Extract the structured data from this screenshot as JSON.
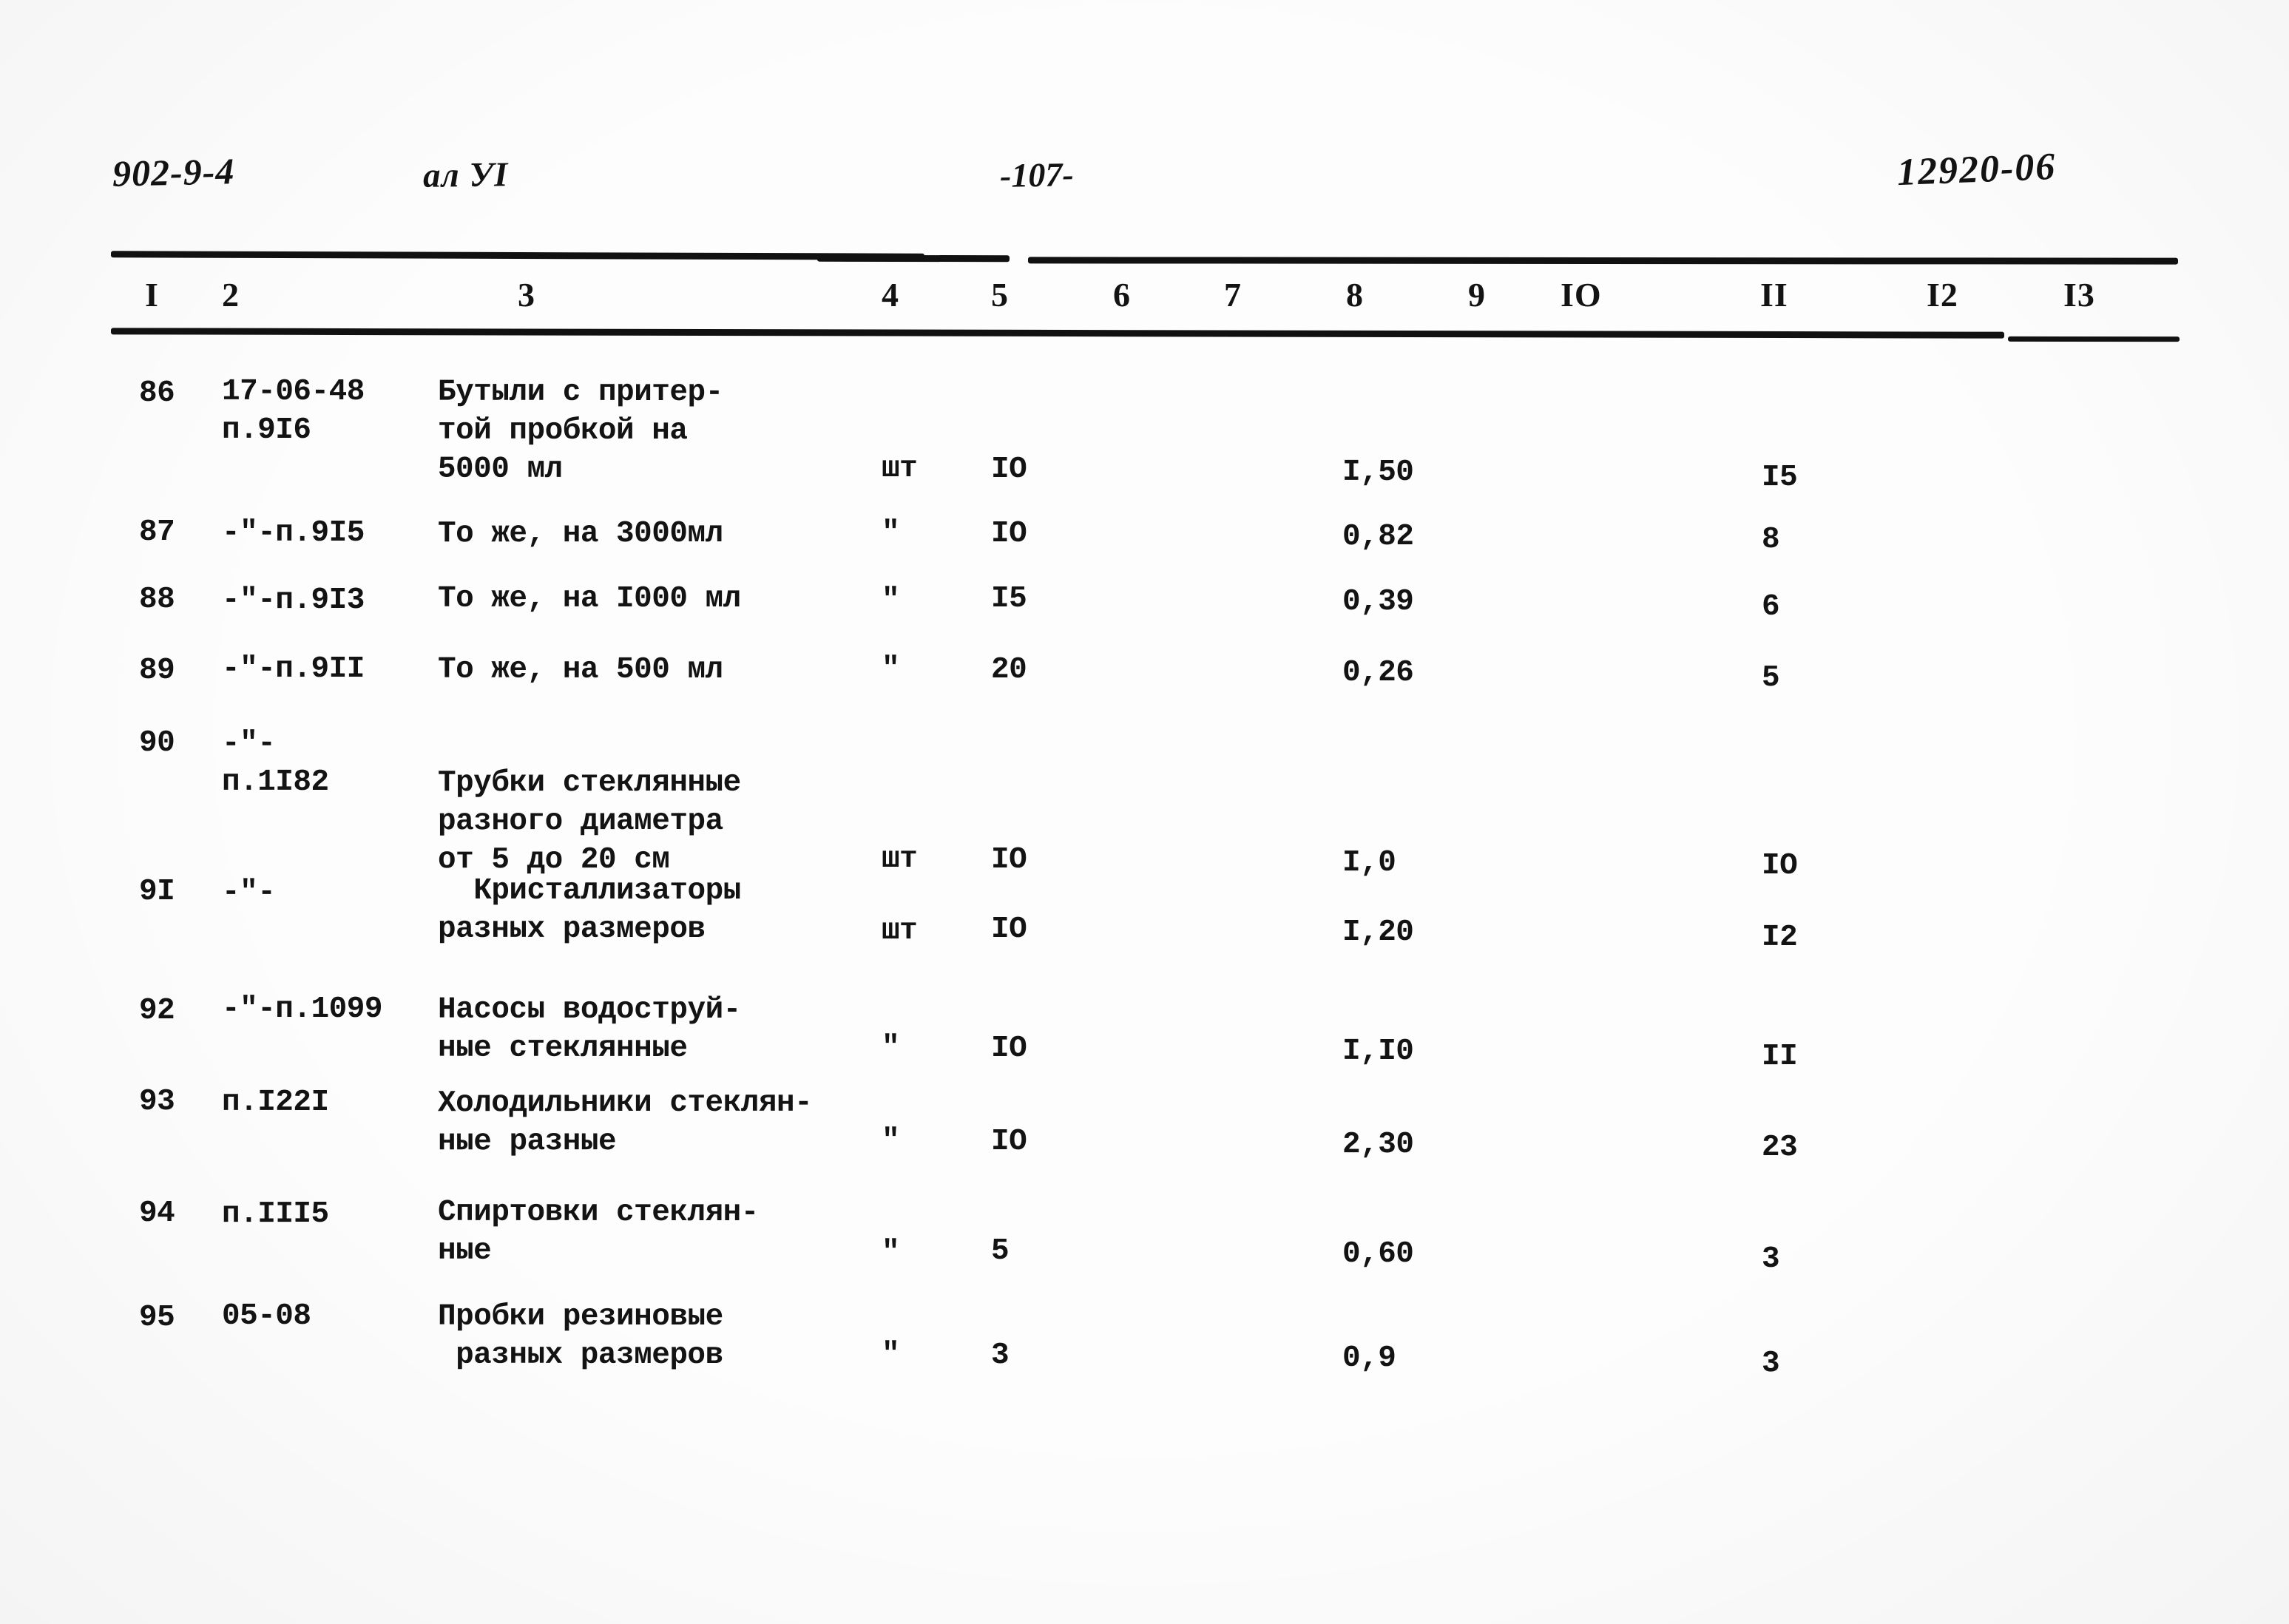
{
  "header": {
    "series_code": "902-9-4",
    "album": "ал УI",
    "page_number": "-107-",
    "document_number": "12920-06"
  },
  "table": {
    "column_numbers": [
      "I",
      "2",
      "3",
      "4",
      "5",
      "6",
      "7",
      "8",
      "9",
      "IO",
      "II",
      "I2",
      "I3"
    ],
    "rows": [
      {
        "no": "86",
        "code": "17-06-48\nп.9I6",
        "name": "Бутыли с притер-\nтой пробкой на\n5000 мл",
        "name_offset_lines": 0,
        "unit": "шт",
        "qty": "IO",
        "price": "I,50",
        "sum": "I5",
        "value_line": 2
      },
      {
        "no": "87",
        "code": "-\"-п.9I5",
        "name": "То же, на 3000мл",
        "name_offset_lines": 0,
        "unit": "\"",
        "qty": "IO",
        "price": "0,82",
        "sum": "8",
        "value_line": 0
      },
      {
        "no": "88",
        "code": "-\"-п.9I3",
        "name": "То же, на I000 мл",
        "name_offset_lines": 0,
        "unit": "\"",
        "qty": "I5",
        "price": "0,39",
        "sum": "6",
        "value_line": 0
      },
      {
        "no": "89",
        "code": "-\"-п.9II",
        "name": "То же, на 500 мл",
        "name_offset_lines": 0,
        "unit": "\"",
        "qty": "20",
        "price": "0,26",
        "sum": "5",
        "value_line": 0
      },
      {
        "no": "90",
        "code": "-\"-\nп.1I82",
        "name": "Трубки стеклянные\nразного диаметра\nот 5 до 20 см",
        "name_offset_lines": 1,
        "unit": "шт",
        "qty": "IO",
        "price": "I,0",
        "sum": "IO",
        "value_line": 3
      },
      {
        "no": "9I",
        "code": "-\"-",
        "name": "  Кристаллизаторы\nразных размеров",
        "name_offset_lines": 0,
        "unit": "шт",
        "qty": "IO",
        "price": "I,20",
        "sum": "I2",
        "value_line": 1
      },
      {
        "no": "92",
        "code": "-\"-п.1099",
        "name": "Насосы водоструй-\nные стеклянные",
        "name_offset_lines": 0,
        "unit": "\"",
        "qty": "IO",
        "price": "I,I0",
        "sum": "II",
        "value_line": 1
      },
      {
        "no": "93",
        "code": "п.I22I",
        "name": "Холодильники стеклян-\nные разные",
        "name_offset_lines": 0,
        "unit": "\"",
        "qty": "IO",
        "price": "2,30",
        "sum": "23",
        "value_line": 1
      },
      {
        "no": "94",
        "code": "п.III5",
        "name": "Спиртовки стеклян-\nные",
        "name_offset_lines": 0,
        "unit": "\"",
        "qty": "5",
        "price": "0,60",
        "sum": "3",
        "value_line": 1
      },
      {
        "no": "95",
        "code": "05-08",
        "name": "Пробки резиновые\n разных размеров",
        "name_offset_lines": 0,
        "unit": "\"",
        "qty": "3",
        "price": "0,9",
        "sum": "3",
        "value_line": 1
      }
    ]
  },
  "layout": {
    "column_number_x": [
      196,
      300,
      700,
      1192,
      1340,
      1505,
      1655,
      1820,
      1985,
      2110,
      2380,
      2605,
      2790
    ],
    "row_tops": [
      505,
      695,
      785,
      880,
      980,
      1180,
      1340,
      1465,
      1615,
      1755
    ],
    "row_line_height": 52,
    "name_line_height": 52
  }
}
